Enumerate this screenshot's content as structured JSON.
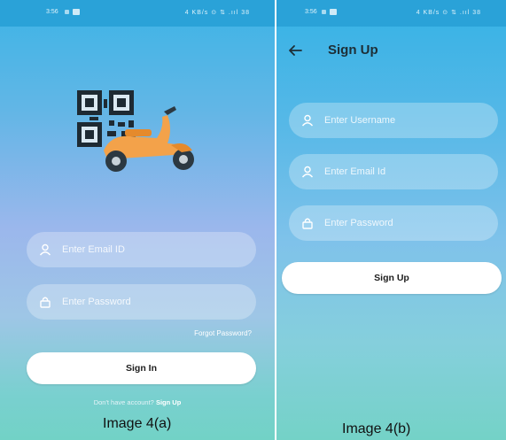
{
  "screen_a": {
    "status": {
      "time": "3:56",
      "right": "4 KB/s ⊙ ⇅ .ııl 38"
    },
    "inputs": {
      "email_placeholder": "Enter Email ID",
      "password_placeholder": "Enter Password"
    },
    "forgot_label": "Forgot Password?",
    "signin_label": "Sign In",
    "no_account_text": "Don't have account?",
    "signup_link": "Sign Up",
    "caption": "Image 4(a)"
  },
  "screen_b": {
    "status": {
      "time": "3:56",
      "right": "4 KB/s ⊙ ⇅ .ııl 38"
    },
    "title": "Sign Up",
    "inputs": {
      "username_placeholder": "Enter Username",
      "email_placeholder": "Enter Email Id",
      "password_placeholder": "Enter Password"
    },
    "signup_label": "Sign Up",
    "caption": "Image 4(b)"
  },
  "colors": {
    "status_bar": "#2aa2d8",
    "gradient_top": "#3cb4e6",
    "gradient_mid": "#9bb7ec",
    "gradient_bottom": "#72d2c6",
    "scooter_orange": "#f3a24a",
    "button_bg": "#ffffff"
  },
  "icons": [
    "back-arrow-icon",
    "user-icon",
    "lock-icon",
    "qr-code-icon",
    "scooter-icon"
  ]
}
